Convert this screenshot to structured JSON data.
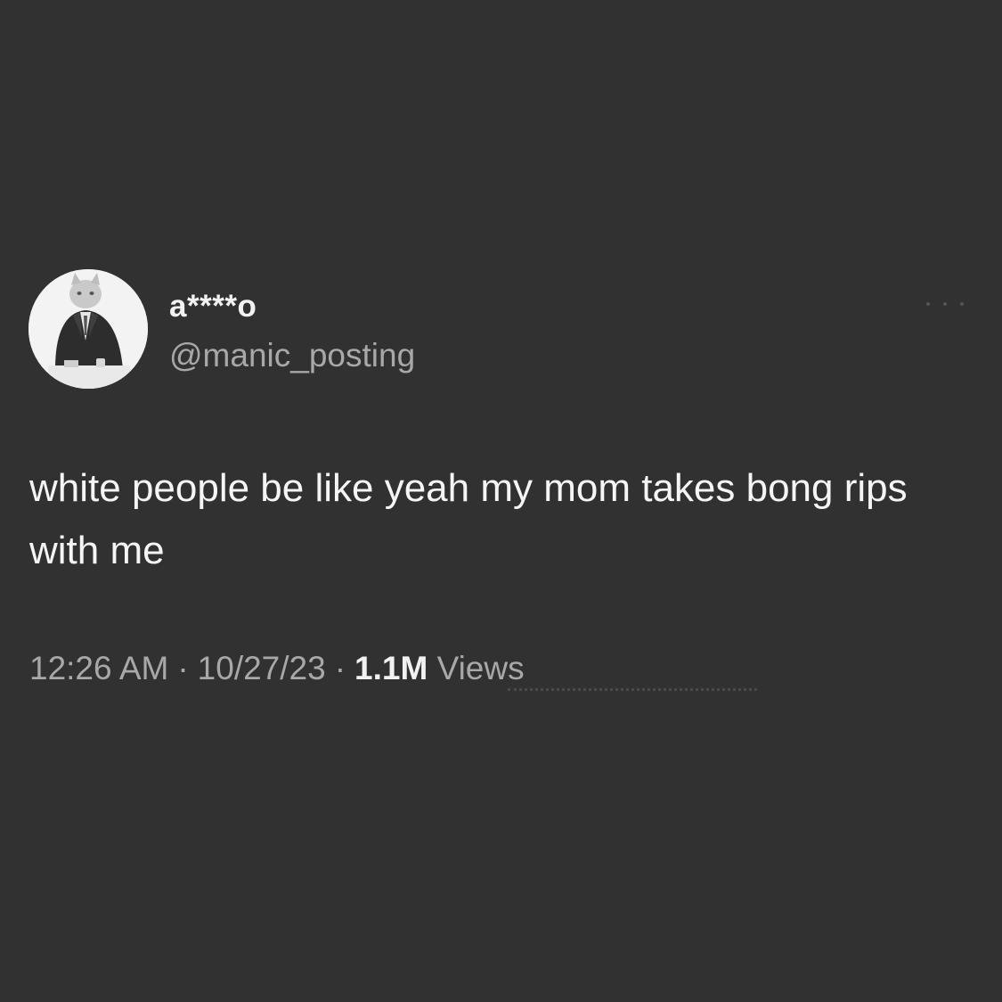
{
  "user": {
    "display_name": "a****o",
    "handle": "@manic_posting",
    "avatar_icon": "cat-in-suit-avatar"
  },
  "tweet": {
    "text": "white people be like yeah my mom takes bong rips with me",
    "time": "12:26 AM",
    "date": "10/27/23",
    "separator": "·",
    "views_count": "1.1M",
    "views_label": "Views"
  },
  "colors": {
    "background": "#313131",
    "primary_text": "#f5f5f5",
    "secondary_text": "#a8a8a8"
  }
}
